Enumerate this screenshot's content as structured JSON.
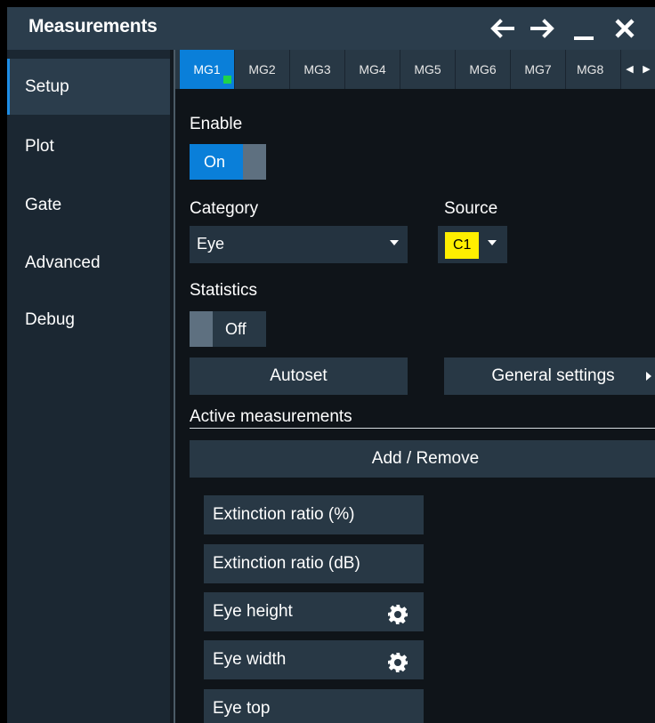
{
  "window": {
    "title": "Measurements",
    "controls": [
      "arrow-left-icon",
      "arrow-right-icon",
      "minimize-icon",
      "close-icon"
    ]
  },
  "sidebar": {
    "items": [
      {
        "label": "Setup",
        "active": true
      },
      {
        "label": "Plot",
        "active": false
      },
      {
        "label": "Gate",
        "active": false
      },
      {
        "label": "Advanced",
        "active": false
      },
      {
        "label": "Debug",
        "active": false
      }
    ]
  },
  "tabs": {
    "items": [
      "MG1",
      "MG2",
      "MG3",
      "MG4",
      "MG5",
      "MG6",
      "MG7",
      "MG8"
    ],
    "active": "MG1",
    "scroll_left_icon": "caret-left-icon",
    "scroll_right_icon": "caret-right-icon"
  },
  "enable": {
    "label": "Enable",
    "state": "On"
  },
  "category": {
    "label": "Category",
    "value": "Eye"
  },
  "source": {
    "label": "Source",
    "value": "C1",
    "color": "#ffef00"
  },
  "statistics": {
    "label": "Statistics",
    "state": "Off"
  },
  "buttons": {
    "autoset": "Autoset",
    "general_settings": "General settings"
  },
  "active_measurements": {
    "title": "Active measurements",
    "add_remove": "Add / Remove",
    "items": [
      {
        "label": "Extinction ratio (%)",
        "has_settings": false
      },
      {
        "label": "Extinction ratio (dB)",
        "has_settings": false
      },
      {
        "label": "Eye height",
        "has_settings": true
      },
      {
        "label": "Eye width",
        "has_settings": true
      },
      {
        "label": "Eye top",
        "has_settings": false
      }
    ]
  },
  "colors": {
    "accent": "#0a7fd9",
    "live_indicator": "#1fd34a",
    "titlebar": "#2b3d4c",
    "panel": "#0f1419"
  }
}
